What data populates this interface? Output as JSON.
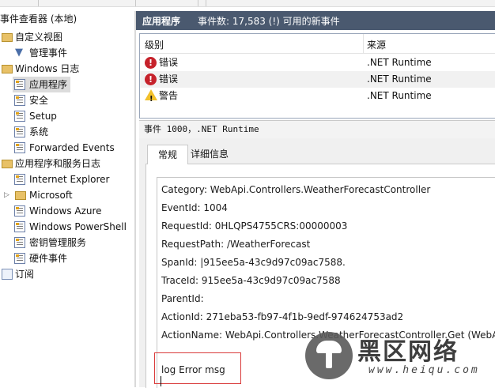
{
  "tree": {
    "root": "事件查看器 (本地)",
    "custom_views": "自定义视图",
    "admin_events": "管理事件",
    "windows_logs": "Windows 日志",
    "app_log": "应用程序",
    "security_log": "安全",
    "setup_log": "Setup",
    "system_log": "系统",
    "forwarded_log": "Forwarded Events",
    "app_services": "应用程序和服务日志",
    "ie": "Internet Explorer",
    "microsoft": "Microsoft",
    "azure": "Windows Azure",
    "powershell": "Windows PowerShell",
    "key_mgmt": "密钥管理服务",
    "hardware": "硬件事件",
    "subscriptions": "订阅"
  },
  "header": {
    "title": "应用程序",
    "summary": "事件数: 17,583 (!) 可用的新事件"
  },
  "grid": {
    "col_level": "级别",
    "col_source": "来源",
    "rows": [
      {
        "level": "错误",
        "source": ".NET Runtime",
        "icon": "error-icon"
      },
      {
        "level": "错误",
        "source": ".NET Runtime",
        "icon": "error-icon"
      },
      {
        "level": "警告",
        "source": ".NET Runtime",
        "icon": "warning-icon"
      }
    ]
  },
  "detail": {
    "title": "事件 1000，.NET Runtime",
    "tab_general": "常规",
    "tab_details": "详细信息",
    "lines": [
      "Category: WebApi.Controllers.WeatherForecastController",
      "EventId: 1004",
      "RequestId: 0HLQPS4755CRS:00000003",
      "RequestPath: /WeatherForecast",
      "SpanId: |915ee5a-43c9d97c09ac7588.",
      "TraceId: 915ee5a-43c9d97c09ac7588",
      "ParentId:",
      "ActionId: 271eba53-fb97-4f1b-9edf-974624753ad2",
      "ActionName: WebApi.Controllers.WeatherForecastController.Get (WebApi)"
    ],
    "message": "log Error msg"
  },
  "watermark": {
    "title": "黑区网络",
    "url": "www.heiqu.com"
  }
}
